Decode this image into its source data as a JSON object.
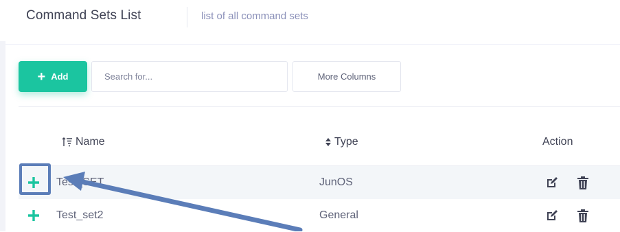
{
  "header": {
    "title": "Command Sets List",
    "subtitle": "list of all command sets"
  },
  "toolbar": {
    "add_label": "Add",
    "search_placeholder": "Search for...",
    "more_columns_label": "More Columns"
  },
  "table": {
    "columns": [
      "Name",
      "Type",
      "Action"
    ],
    "rows": [
      {
        "name": "Test_SET",
        "type": "JunOS"
      },
      {
        "name": "Test_set2",
        "type": "General"
      }
    ]
  },
  "icons": {
    "expand": "plus-icon",
    "edit": "edit-icon",
    "delete": "trash-icon",
    "sort_active": "sort-ascending-icon",
    "sort": "sort-icon"
  },
  "colors": {
    "accent": "#1bc5a0",
    "annotation": "#5b7db8"
  }
}
